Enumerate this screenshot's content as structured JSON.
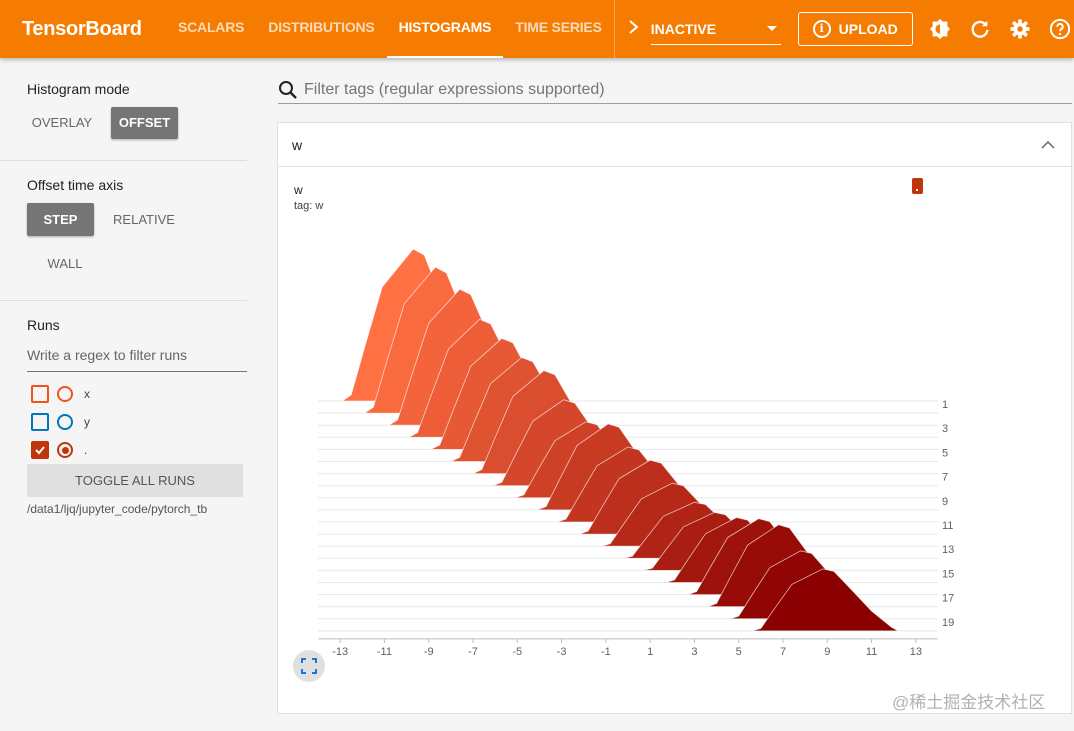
{
  "app": {
    "brand": "TensorBoard"
  },
  "nav": {
    "tabs": [
      "SCALARS",
      "DISTRIBUTIONS",
      "HISTOGRAMS",
      "TIME SERIES"
    ],
    "active_tab": "HISTOGRAMS",
    "run_selector": "INACTIVE",
    "upload_label": "UPLOAD",
    "icons": [
      "theme-icon",
      "reload-icon",
      "settings-icon",
      "help-icon"
    ]
  },
  "sidebar": {
    "histogram_mode": {
      "title": "Histogram mode",
      "options": [
        "OVERLAY",
        "OFFSET"
      ],
      "selected": "OFFSET"
    },
    "offset_time_axis": {
      "title": "Offset time axis",
      "options": [
        "STEP",
        "RELATIVE",
        "WALL"
      ],
      "selected": "STEP"
    },
    "runs": {
      "title": "Runs",
      "filter_placeholder": "Write a regex to filter runs",
      "items": [
        {
          "label": "x",
          "checked": false,
          "color": "#f4511e"
        },
        {
          "label": "y",
          "checked": false,
          "color": "#0077bb"
        },
        {
          "label": ".",
          "checked": true,
          "color": "#c1350d"
        }
      ],
      "toggle_all_label": "TOGGLE ALL RUNS",
      "logdir": "/data1/ljq/jupyter_code/pytorch_tb"
    }
  },
  "main": {
    "search_placeholder": "Filter tags (regular expressions supported)",
    "card": {
      "title": "w",
      "chart_title": "w",
      "chart_tag": "tag: w",
      "legend_color": "#c1350d"
    }
  },
  "chart_data": {
    "type": "histogram-offset",
    "title": "w",
    "x_ticks": [
      -13,
      -11,
      -9,
      -7,
      -5,
      -3,
      -1,
      1,
      3,
      5,
      7,
      9,
      11,
      13
    ],
    "step_ticks": [
      1,
      3,
      5,
      7,
      9,
      11,
      13,
      15,
      17,
      19
    ],
    "xlim": [
      -14,
      14
    ],
    "steps": [
      0,
      1,
      2,
      3,
      4,
      5,
      6,
      7,
      8,
      9,
      10,
      11,
      12,
      13,
      14,
      15,
      16,
      17,
      18,
      19
    ],
    "series_peak_x": [
      -9.7,
      -8.7,
      -7.6,
      -6.7,
      -5.7,
      -4.8,
      -3.8,
      -2.9,
      -1.9,
      -0.9,
      0.0,
      1.0,
      2.0,
      3.0,
      3.9,
      4.9,
      5.9,
      6.8,
      7.8,
      8.8
    ],
    "series_peak_height": [
      152,
      146,
      136,
      118,
      111,
      104,
      103,
      86,
      76,
      86,
      75,
      74,
      63,
      56,
      58,
      65,
      76,
      82,
      68,
      62
    ],
    "color_start": "#ff7043",
    "color_end": "#8b0000",
    "watermark": "@稀土掘金技术社区"
  }
}
